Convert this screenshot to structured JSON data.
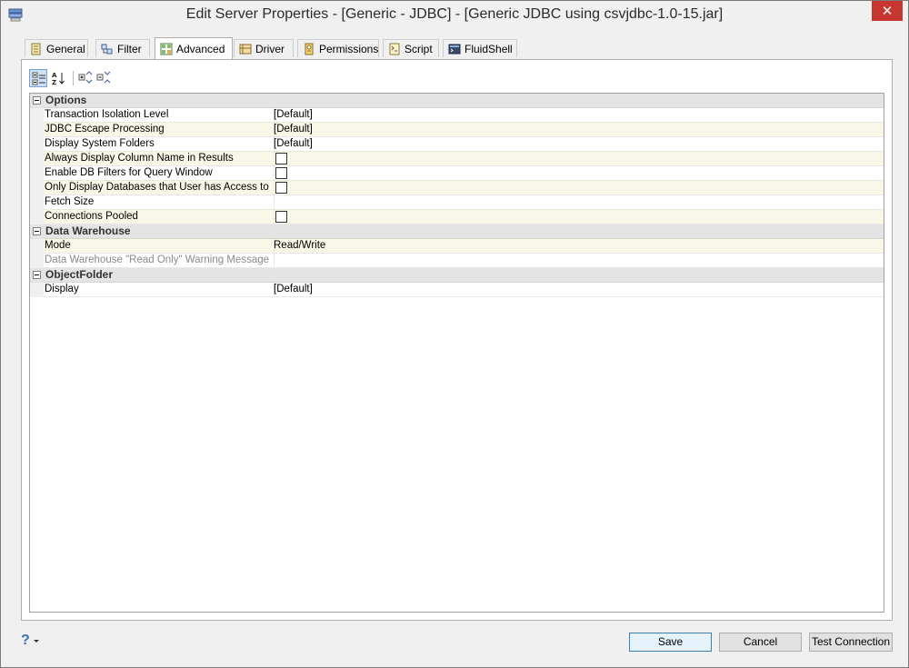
{
  "window": {
    "title": "Edit Server Properties - [Generic - JDBC] - [Generic JDBC using csvjdbc-1.0-15.jar]",
    "close_glyph": "✕"
  },
  "tabs": [
    {
      "label": "General",
      "icon": "general-icon"
    },
    {
      "label": "Filter",
      "icon": "filter-icon"
    },
    {
      "label": "Advanced",
      "icon": "advanced-icon",
      "active": true
    },
    {
      "label": "Driver",
      "icon": "driver-icon"
    },
    {
      "label": "Permissions",
      "icon": "permissions-icon"
    },
    {
      "label": "Script",
      "icon": "script-icon"
    },
    {
      "label": "FluidShell",
      "icon": "fluidshell-icon"
    }
  ],
  "toolbar": {
    "buttons": [
      "categorized-icon",
      "alphabetical-icon",
      "expand-all-icon",
      "collapse-all-icon"
    ]
  },
  "categories": [
    {
      "label": "Options",
      "properties": [
        {
          "name": "Transaction Isolation Level",
          "value": "[Default]"
        },
        {
          "name": "JDBC Escape Processing",
          "value": "[Default]"
        },
        {
          "name": "Display System Folders",
          "value": "[Default]"
        },
        {
          "name": "Always Display Column Name in Results",
          "checkbox": true
        },
        {
          "name": "Enable DB Filters for Query Window",
          "checkbox": true
        },
        {
          "name": "Only Display Databases that User has Access to",
          "checkbox": true
        },
        {
          "name": "Fetch Size",
          "value": ""
        },
        {
          "name": "Connections Pooled",
          "checkbox": true
        }
      ]
    },
    {
      "label": "Data Warehouse",
      "properties": [
        {
          "name": "Mode",
          "value": "Read/Write"
        },
        {
          "name": "Data Warehouse \"Read Only\" Warning Message",
          "value": "",
          "disabled": true
        }
      ]
    },
    {
      "label": "ObjectFolder",
      "properties": [
        {
          "name": "Display",
          "value": "[Default]"
        }
      ]
    }
  ],
  "footer": {
    "help_glyph": "?",
    "save": "Save",
    "cancel": "Cancel",
    "test_connection": "Test Connection"
  }
}
